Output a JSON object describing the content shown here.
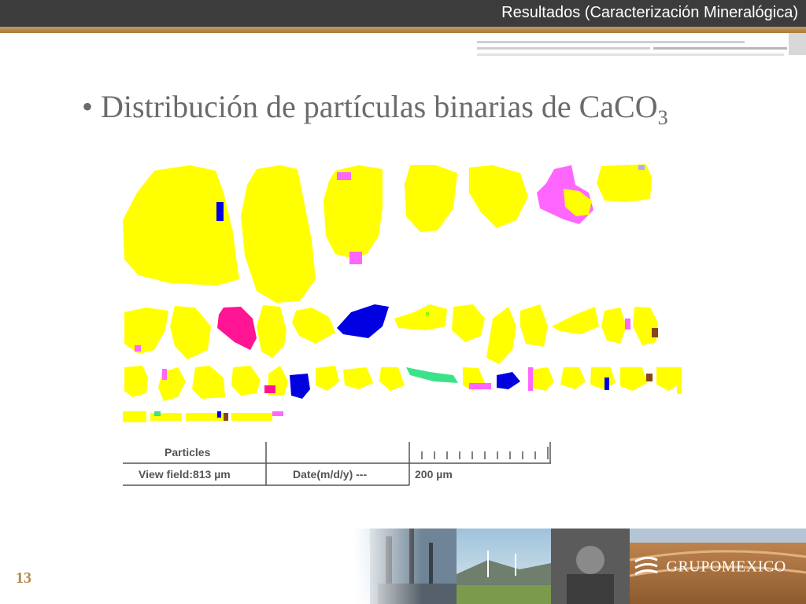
{
  "header": {
    "title": "Resultados (Caracterización Mineralógica)"
  },
  "slide": {
    "bullet_main": "Distribución de partículas binarias de CaCO",
    "bullet_sub": "3"
  },
  "info_table": {
    "particles_label": "Particles",
    "view_field": "View field:813 µm",
    "date": "Date(m/d/y) ---",
    "scale": "200 µm"
  },
  "footer": {
    "page_number": "13",
    "logo_text": "GRUPOMEXICO"
  },
  "colors": {
    "topbar": "#3c3c3c",
    "accent_bronze": "#b08a4f",
    "mineral_main": "#ffff00",
    "mineral_magenta": "#ff66ff",
    "mineral_pink": "#ff1493",
    "mineral_blue": "#0000e0",
    "mineral_green": "#3ce28a",
    "mineral_brown": "#8b4513"
  }
}
